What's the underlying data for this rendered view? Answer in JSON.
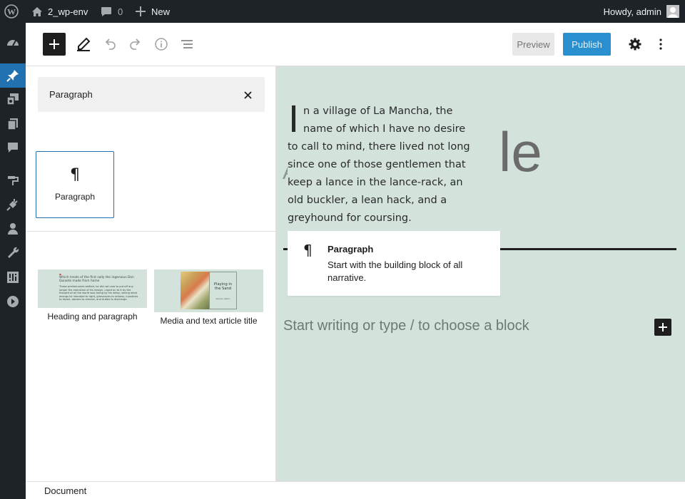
{
  "adminbar": {
    "site_name": "2_wp-env",
    "comments_count": "0",
    "new_label": "New",
    "greeting": "Howdy, admin"
  },
  "toolbar": {
    "preview_label": "Preview",
    "publish_label": "Publish"
  },
  "inserter": {
    "search_value": "Paragraph",
    "block_label": "Paragraph",
    "patterns": [
      {
        "label": "Heading and paragraph"
      },
      {
        "label": "Media and text article title"
      }
    ],
    "pattern_thumb_heading": "Which treats of the first sally the ingenious Don Quixote made from home",
    "pattern_thumb_body": "These preliminaries settled, he did not care to put off any longer the execution of his design, urged on to it by the thought of all the world was losing by his delay, seeing what wrongs he intended to right, grievances to redress, injustices to repair, abuses to remove, and duties to discharge.",
    "pattern_thumb_media_title": "Playing in the Sand",
    "pattern_thumb_media_caption": "Sample caption"
  },
  "canvas": {
    "title_partial": "le",
    "title_left": "A",
    "paragraph_dropcap": "I",
    "paragraph_text": "n a village of La Mancha, the name of which I have no desire to call to mind, there lived not long since one of those gentlemen that keep a lance in the lance-rack, an old buckler, a lean hack, and a greyhound for coursing.",
    "preview_title": "Paragraph",
    "preview_desc": "Start with the building block of all narrative.",
    "placeholder": "Start writing or type / to choose a block"
  },
  "footer": {
    "label": "Document"
  },
  "colors": {
    "accent": "#2271b1",
    "publish": "#007cba",
    "canvas_bg": "#d3e3dc",
    "admin_bg": "#1d2327"
  }
}
